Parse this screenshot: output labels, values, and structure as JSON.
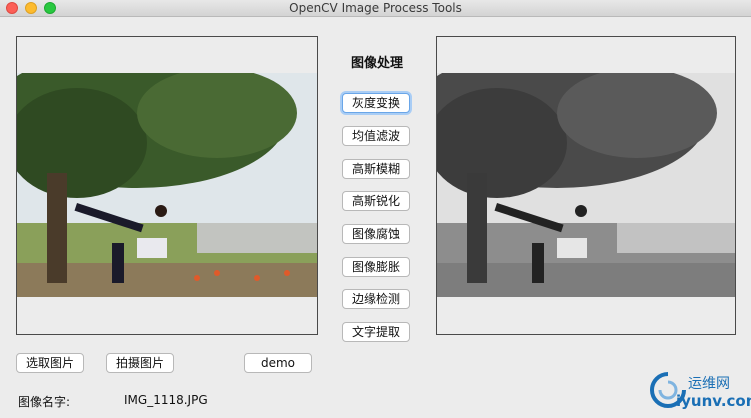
{
  "window": {
    "title": "OpenCV Image Process Tools"
  },
  "panel": {
    "heading": "图像处理"
  },
  "buttons": [
    "灰度变换",
    "均值滤波",
    "高斯模糊",
    "高斯锐化",
    "图像腐蚀",
    "图像膨胀",
    "边缘检测",
    "文字提取"
  ],
  "bottom": {
    "select_image": "选取图片",
    "capture_image": "拍摄图片",
    "demo": "demo",
    "name_label": "图像名字:",
    "name_value": "IMG_1118.JPG"
  },
  "watermark": {
    "brand": "运维网",
    "domain": "iyunv.com"
  }
}
